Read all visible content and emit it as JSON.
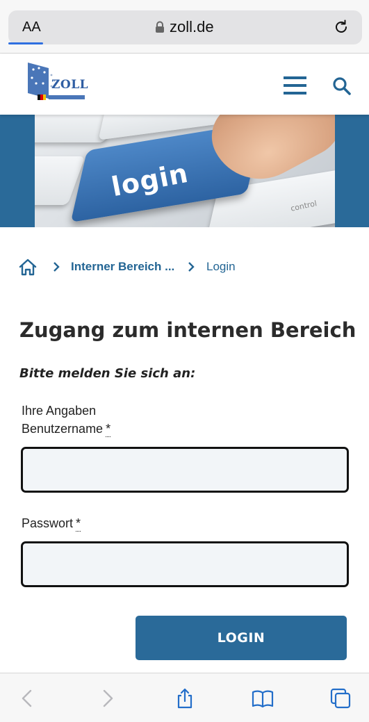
{
  "browser": {
    "text_size_label": "AA",
    "url": "zoll.de"
  },
  "header": {
    "logo_text": "ZOLL"
  },
  "hero": {
    "key_label": "login",
    "control_key_label": "control"
  },
  "breadcrumb": {
    "items": [
      {
        "label": "Interner Bereich ..."
      },
      {
        "label": "Login"
      }
    ]
  },
  "main": {
    "title": "Zugang zum internen Bereich",
    "intro": "Bitte melden Sie sich an:",
    "legend": "Ihre Angaben",
    "fields": {
      "username": {
        "label": "Benutzername",
        "required_marker": "*",
        "value": ""
      },
      "password": {
        "label": "Passwort",
        "required_marker": "*",
        "value": ""
      }
    },
    "submit_label": "LOGIN"
  },
  "colors": {
    "brand_blue": "#2a6a99",
    "link_blue": "#236594",
    "input_bg": "#f2f5f8"
  },
  "icons": [
    "lock-icon",
    "reload-icon",
    "menu-icon",
    "search-icon",
    "home-icon",
    "chevron-right-icon",
    "back-icon",
    "forward-icon",
    "share-icon",
    "bookmarks-icon",
    "tabs-icon"
  ]
}
